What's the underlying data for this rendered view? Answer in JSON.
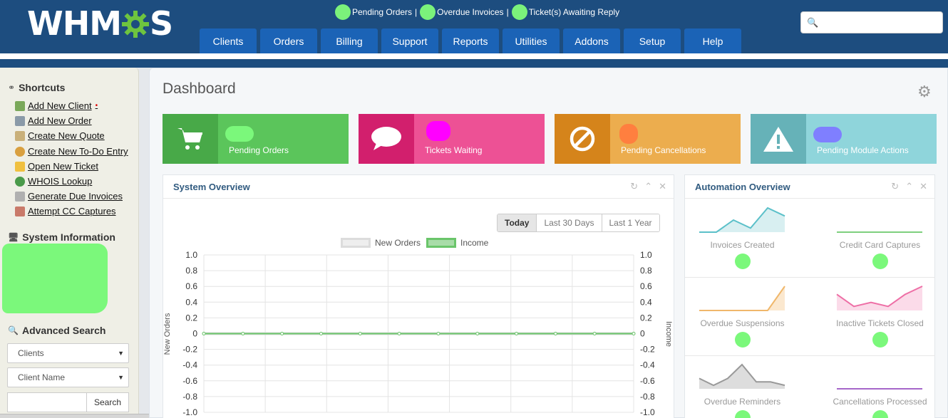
{
  "header": {
    "logo": {
      "prefix": "WHM",
      "suffix": "S"
    },
    "alerts": [
      {
        "label": "Pending Orders"
      },
      {
        "label": "Overdue Invoices"
      },
      {
        "label": "Ticket(s) Awaiting Reply"
      }
    ],
    "alert_separator": "|",
    "nav": [
      "Clients",
      "Orders",
      "Billing",
      "Support",
      "Reports",
      "Utilities",
      "Addons",
      "Setup",
      "Help"
    ],
    "search": {
      "value": "",
      "placeholder": ""
    }
  },
  "sidebar": {
    "shortcuts_title": "Shortcuts",
    "shortcuts": [
      {
        "label": "Add New Client",
        "icon": "add-client-icon"
      },
      {
        "label": "Add New Order",
        "icon": "cart-icon"
      },
      {
        "label": "Create New Quote",
        "icon": "quote-icon"
      },
      {
        "label": "Create New To-Do Entry",
        "icon": "todo-icon"
      },
      {
        "label": "Open New Ticket",
        "icon": "ticket-icon"
      },
      {
        "label": "WHOIS Lookup",
        "icon": "globe-icon"
      },
      {
        "label": "Generate Due Invoices",
        "icon": "invoice-icon"
      },
      {
        "label": "Attempt CC Captures",
        "icon": "cc-icon"
      }
    ],
    "new_indicator": "•",
    "sysinfo_title": "System Information",
    "adv_search_title": "Advanced Search",
    "search_type": "Clients",
    "search_field": "Client Name",
    "search_value": "",
    "search_button": "Search"
  },
  "main": {
    "title": "Dashboard",
    "tiles": [
      {
        "label": "Pending Orders",
        "icon": "cart-icon",
        "icon_bg": "#48a948",
        "bg": "#5bc55b",
        "blob": "#7bf87b"
      },
      {
        "label": "Tickets Waiting",
        "icon": "chat-bubble-icon",
        "icon_bg": "#d21f6d",
        "bg": "#ed5195",
        "blob": "#ff00ff"
      },
      {
        "label": "Pending Cancellations",
        "icon": "ban-icon",
        "icon_bg": "#d5841b",
        "bg": "#ecad4e",
        "blob": "#ff7f3f"
      },
      {
        "label": "Pending Module Actions",
        "icon": "warning-icon",
        "icon_bg": "#66b2b8",
        "bg": "#8fd5db",
        "blob": "#7f7fff"
      }
    ],
    "system_overview": {
      "title": "System Overview",
      "ranges": [
        "Today",
        "Last 30 Days",
        "Last 1 Year"
      ],
      "active_range": "Today"
    },
    "automation": {
      "title": "Automation Overview",
      "items": [
        {
          "label": "Invoices Created",
          "color": "#5bc0c9",
          "fill": "#d8eff1",
          "values": [
            0,
            0,
            3,
            1,
            6,
            4
          ]
        },
        {
          "label": "Credit Card Captures",
          "color": "#7ed07e",
          "fill": "none",
          "values": [
            0,
            0,
            0,
            0,
            0,
            0
          ]
        },
        {
          "label": "Overdue Suspensions",
          "color": "#f0b76b",
          "fill": "#fbe8cf",
          "values": [
            0,
            0,
            0,
            0,
            0,
            5
          ]
        },
        {
          "label": "Inactive Tickets Closed",
          "color": "#ee6fa6",
          "fill": "#fbdbe9",
          "values": [
            4,
            1,
            2,
            1,
            4,
            6
          ]
        },
        {
          "label": "Overdue Reminders",
          "color": "#999999",
          "fill": "#dddddd",
          "values": [
            3,
            1,
            3,
            7,
            2,
            2,
            1
          ]
        },
        {
          "label": "Cancellations Processed",
          "color": "#a566c9",
          "fill": "none",
          "values": [
            0,
            0,
            0,
            0,
            0,
            0
          ]
        }
      ]
    }
  },
  "chart_data": {
    "type": "line",
    "title": "",
    "legend": [
      "New Orders",
      "Income"
    ],
    "legend_placement": "top",
    "ylabel": "New Orders",
    "y2label": "Income",
    "ylim": [
      -1.0,
      1.0
    ],
    "y2lim": [
      -1.0,
      1.0
    ],
    "yticks": [
      1.0,
      0.8,
      0.6,
      0.4,
      0.2,
      0,
      -0.2,
      -0.4,
      -0.6,
      -0.8,
      -1.0
    ],
    "grid": true,
    "series": [
      {
        "name": "New Orders",
        "color": "#dcdcdc",
        "values": [
          0,
          0,
          0,
          0,
          0,
          0,
          0,
          0,
          0,
          0,
          0,
          0
        ]
      },
      {
        "name": "Income",
        "color": "#6ac56a",
        "values": [
          0,
          0,
          0,
          0,
          0,
          0,
          0,
          0,
          0,
          0,
          0,
          0
        ]
      }
    ]
  }
}
